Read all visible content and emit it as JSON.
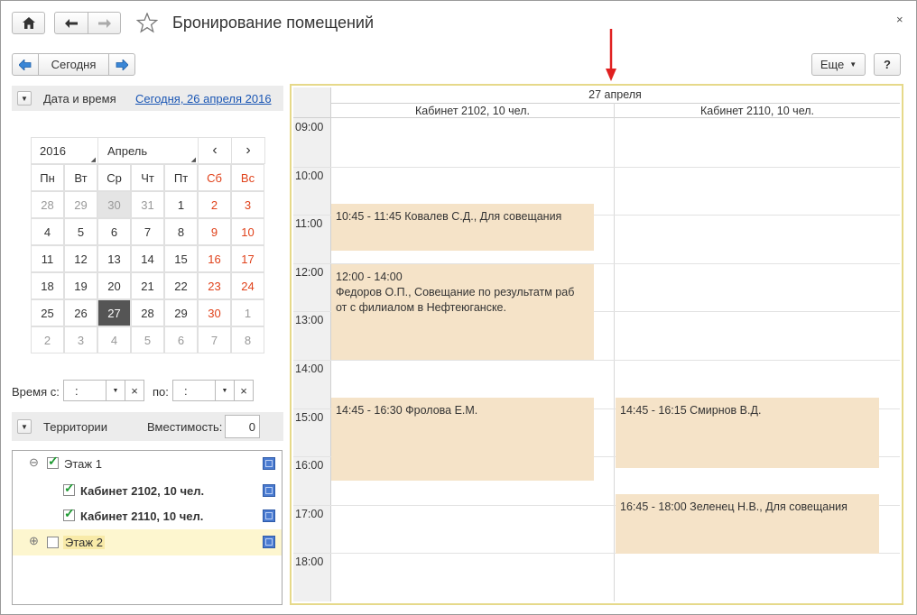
{
  "window": {
    "title": "Бронирование помещений",
    "close_glyph": "×"
  },
  "toolbar": {
    "today_label": "Сегодня",
    "more_label": "Еще",
    "help_label": "?"
  },
  "datetime_section": {
    "label": "Дата и время",
    "selected_date_link": "Сегодня, 26 апреля 2016"
  },
  "calendar": {
    "year": "2016",
    "month": "Апрель",
    "prev_glyph": "‹",
    "next_glyph": "›",
    "weekdays": [
      "Пн",
      "Вт",
      "Ср",
      "Чт",
      "Пт",
      "Сб",
      "Вс"
    ],
    "weeks": [
      [
        "28",
        "29",
        "30",
        "31",
        "1",
        "2",
        "3"
      ],
      [
        "4",
        "5",
        "6",
        "7",
        "8",
        "9",
        "10"
      ],
      [
        "11",
        "12",
        "13",
        "14",
        "15",
        "16",
        "17"
      ],
      [
        "18",
        "19",
        "20",
        "21",
        "22",
        "23",
        "24"
      ],
      [
        "25",
        "26",
        "27",
        "28",
        "29",
        "30",
        "1"
      ],
      [
        "2",
        "3",
        "4",
        "5",
        "6",
        "7",
        "8"
      ]
    ],
    "weekend_color": "#e0421b",
    "selected_day": "27"
  },
  "time_filter": {
    "from_label": "Время с:",
    "from_value": ":",
    "to_label": "по:",
    "to_value": ":",
    "clear_glyph": "×"
  },
  "territories_section": {
    "label": "Территории",
    "capacity_label": "Вместимость:",
    "capacity_value": "0"
  },
  "tree": {
    "items": [
      {
        "label": "Этаж 1",
        "checked": true,
        "expand": "⊖"
      },
      {
        "label": "Кабинет 2102, 10 чел.",
        "checked": true
      },
      {
        "label": "Кабинет 2110, 10 чел.",
        "checked": true
      },
      {
        "label": "Этаж 2",
        "checked": false,
        "expand": "⊕"
      }
    ]
  },
  "planner": {
    "date_header": "27 апреля",
    "columns": [
      "Кабинет 2102, 10 чел.",
      "Кабинет 2110, 10 чел."
    ],
    "hours": [
      "09:00",
      "10:00",
      "11:00",
      "12:00",
      "13:00",
      "14:00",
      "15:00",
      "16:00",
      "17:00",
      "18:00"
    ],
    "events": [
      {
        "text": "10:45 - 11:45 Ковалев С.Д., Для совещания"
      },
      {
        "text": "12:00 - 14:00\nФедоров О.П., Совещание по результатм раб\nот с филиалом в Нефтеюганске."
      },
      {
        "text": "14:45 - 16:30 Фролова Е.М."
      },
      {
        "text": "14:45 - 16:15 Смирнов В.Д."
      },
      {
        "text": "16:45 - 18:00 Зеленец Н.В., Для совещания"
      }
    ],
    "event_color": "#f5e3c8",
    "annotation_color": "#e02020"
  }
}
